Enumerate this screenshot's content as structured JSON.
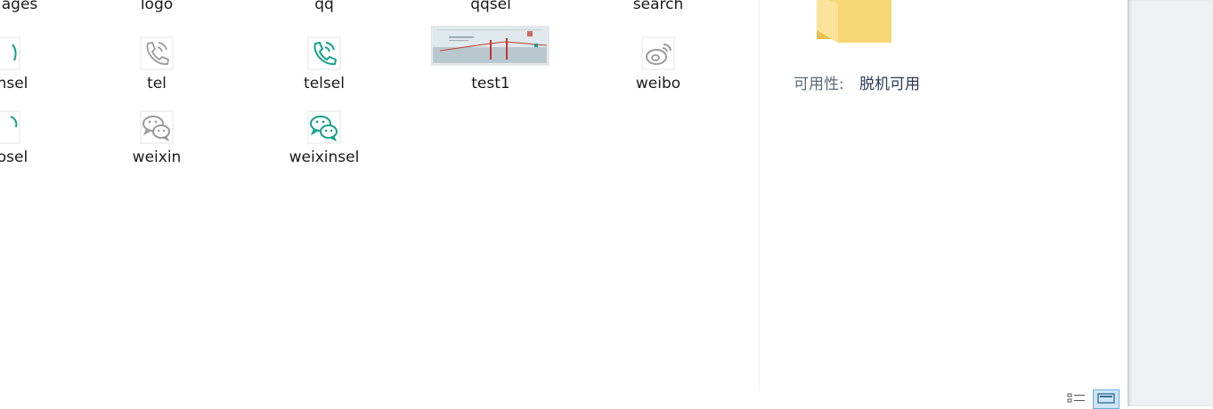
{
  "files": {
    "row1": [
      "ages",
      "logo",
      "qq",
      "qqsel",
      "search"
    ],
    "row2": [
      "nsel",
      "tel",
      "telsel",
      "test1",
      "weibo"
    ],
    "row3": [
      "osel",
      "weixin",
      "weixinsel"
    ]
  },
  "details": {
    "label": "可用性:",
    "value": "脱机可用"
  },
  "colors": {
    "teal": "#14a08a",
    "gray_icon": "#9a9a9a",
    "folder": "#f7d774"
  },
  "view_buttons": {
    "details": "details-view-icon",
    "large_icons": "large-icons-view-icon"
  }
}
